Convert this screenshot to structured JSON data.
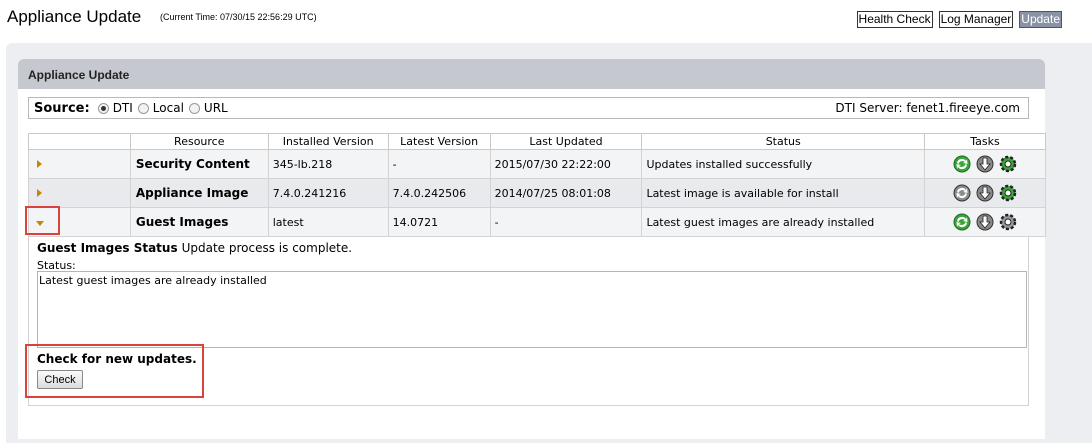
{
  "header": {
    "title": "Appliance Update",
    "current_time": "(Current Time: 07/30/15 22:56:29 UTC)",
    "nav": [
      {
        "label": "Health Check"
      },
      {
        "label": "Log Manager"
      },
      {
        "label": "Update"
      }
    ]
  },
  "panel": {
    "title": "Appliance Update",
    "source_label": "Source:",
    "source_options": [
      {
        "label": "DTI",
        "checked": true
      },
      {
        "label": "Local",
        "checked": false
      },
      {
        "label": "URL",
        "checked": false
      }
    ],
    "dti_server": "DTI Server: fenet1.fireeye.com"
  },
  "table": {
    "headers": [
      "",
      "Resource",
      "Installed Version",
      "Latest Version",
      "Last Updated",
      "Status",
      "Tasks"
    ],
    "rows": [
      {
        "expanded": false,
        "resource": "Security Content",
        "installed": "345-lb.218",
        "latest": "-",
        "last_updated": "2015/07/30 22:22:00",
        "status": "Updates installed successfully",
        "tasks": [
          "update-green-icon",
          "download-icon",
          "settings-green-icon"
        ]
      },
      {
        "expanded": false,
        "resource": "Appliance Image",
        "installed": "7.4.0.241216",
        "latest": "7.4.0.242506",
        "last_updated": "2014/07/25 08:01:08",
        "status": "Latest image is available for install",
        "tasks": [
          "update-gray-icon",
          "download-icon",
          "settings-green-icon"
        ]
      },
      {
        "expanded": true,
        "resource": "Guest Images",
        "installed": "latest",
        "latest": "14.0721",
        "last_updated": "-",
        "status": "Latest guest images are already installed",
        "tasks": [
          "update-green-icon",
          "download-icon",
          "settings-gray-icon"
        ]
      }
    ]
  },
  "detail": {
    "status_title": "Guest Images Status",
    "status_message": "Update process is complete.",
    "status_label": "Status:",
    "status_text": "Latest guest images are already installed",
    "check_text": "Check for new updates.",
    "check_button": "Check"
  },
  "colors": {
    "highlight": "#d9423d",
    "arrow": "#c88500",
    "active_nav": "#8a93a6",
    "panel_header": "#c5c9cf",
    "icon_green": "#3aa53a"
  }
}
